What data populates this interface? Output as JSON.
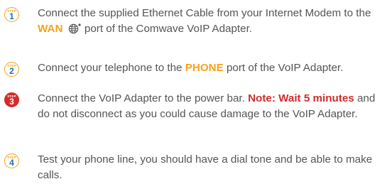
{
  "colors": {
    "text": "#555557",
    "accent_orange": "#f7a11a",
    "accent_red": "#d32b2b",
    "step_number_blue": "#1f6fb2"
  },
  "steps": [
    {
      "badge_label": "STEP",
      "number": "1",
      "text_part1": "Connect the supplied Ethernet Cable from your Internet Modem to the ",
      "highlight": "WAN",
      "icon": "globe-icon",
      "text_part2": " port of the Comwave VoIP Adapter."
    },
    {
      "badge_label": "STEP",
      "number": "2",
      "text_part1": "Connect your telephone to the ",
      "highlight": "PHONE",
      "text_part2": " port of the VoIP Adapter."
    },
    {
      "badge_label": "STEP",
      "number": "3",
      "text_part1": "Connect the VoIP Adapter to the power bar. ",
      "highlight": "Note: Wait 5 minutes",
      "text_part2": " and do not disconnect as you could cause damage to the VoIP Adapter."
    },
    {
      "badge_label": "STEP",
      "number": "4",
      "text": "Test your phone line, you should have a dial tone and be able to make calls."
    }
  ]
}
